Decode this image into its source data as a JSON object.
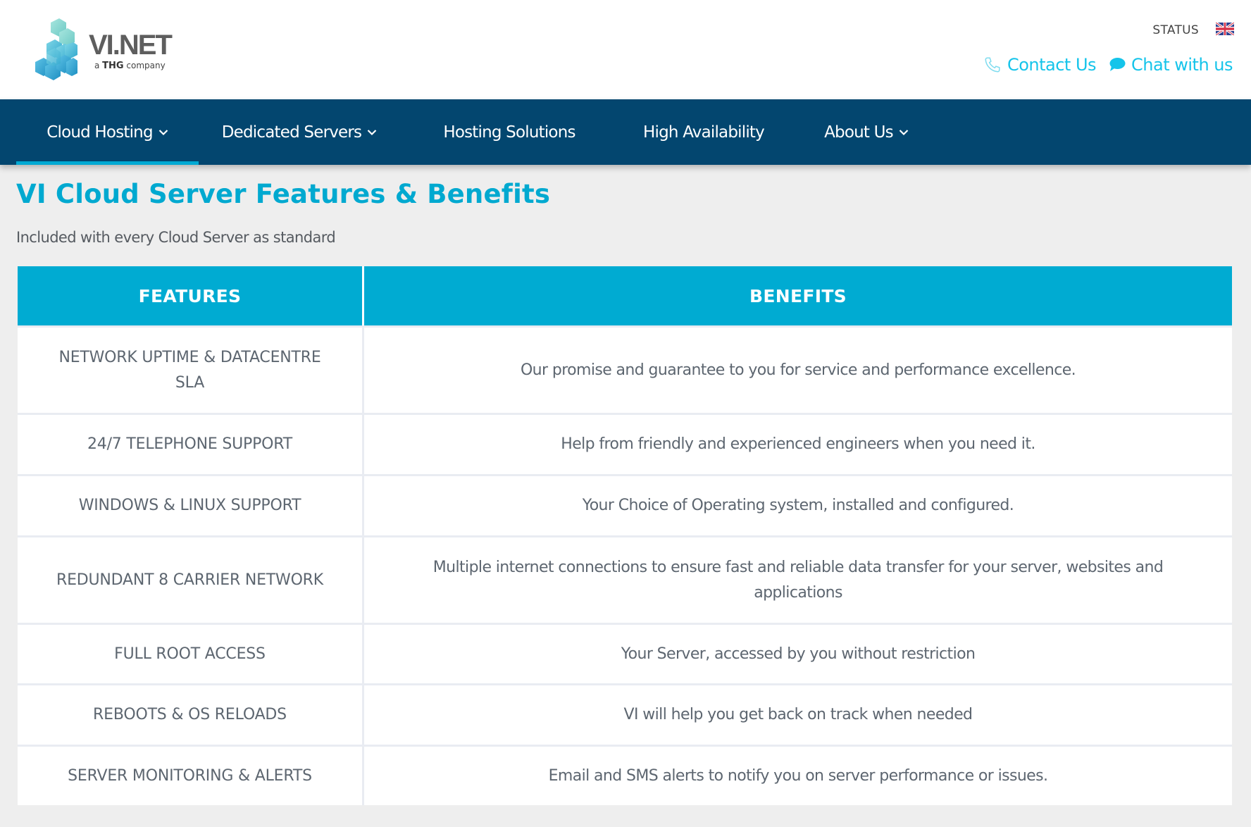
{
  "brand": {
    "name": "VI.NET",
    "tagline_prefix": "a ",
    "tagline_bold": "THG",
    "tagline_suffix": " company",
    "logo_icon": "stacked-cubes-icon"
  },
  "header": {
    "status_label": "STATUS",
    "language_flag": "uk-flag-icon",
    "contact_label": "Contact Us",
    "contact_icon": "phone-icon",
    "chat_label": "Chat with us",
    "chat_icon": "chat-bubble-icon"
  },
  "nav": {
    "items": [
      {
        "label": "Cloud Hosting",
        "has_dropdown": true,
        "active": true
      },
      {
        "label": "Dedicated Servers",
        "has_dropdown": true,
        "active": false
      },
      {
        "label": "Hosting Solutions",
        "has_dropdown": false,
        "active": false
      },
      {
        "label": "High Availability",
        "has_dropdown": false,
        "active": false
      },
      {
        "label": "About Us",
        "has_dropdown": true,
        "active": false
      }
    ]
  },
  "main": {
    "title": "VI Cloud Server Features & Benefits",
    "subtitle": "Included with every Cloud Server as standard",
    "table": {
      "headers": [
        "FEATURES",
        "BENEFITS"
      ],
      "rows": [
        {
          "feature": "NETWORK UPTIME & DATACENTRE SLA",
          "benefit": "Our promise and guarantee to you for service and performance excellence."
        },
        {
          "feature": "24/7 TELEPHONE SUPPORT",
          "benefit": "Help from friendly and experienced engineers when you need it."
        },
        {
          "feature": "WINDOWS & LINUX SUPPORT",
          "benefit": "Your Choice of Operating system, installed and configured."
        },
        {
          "feature": "REDUNDANT 8 CARRIER NETWORK",
          "benefit": "Multiple internet connections to ensure fast and reliable data transfer for your server, websites and applications"
        },
        {
          "feature": "FULL ROOT ACCESS",
          "benefit": "Your Server, accessed by you without restriction"
        },
        {
          "feature": "REBOOTS & OS RELOADS",
          "benefit": "VI will help you get back on track when needed"
        },
        {
          "feature": "SERVER MONITORING & ALERTS",
          "benefit": "Email and SMS alerts to notify you on server performance or issues."
        }
      ]
    }
  },
  "colors": {
    "nav_bg": "#03466f",
    "accent": "#00a9d0",
    "link": "#15c4ea",
    "table_header_bg": "#00abd2",
    "body_text": "#5d6670",
    "page_bg": "#eeeeee"
  }
}
